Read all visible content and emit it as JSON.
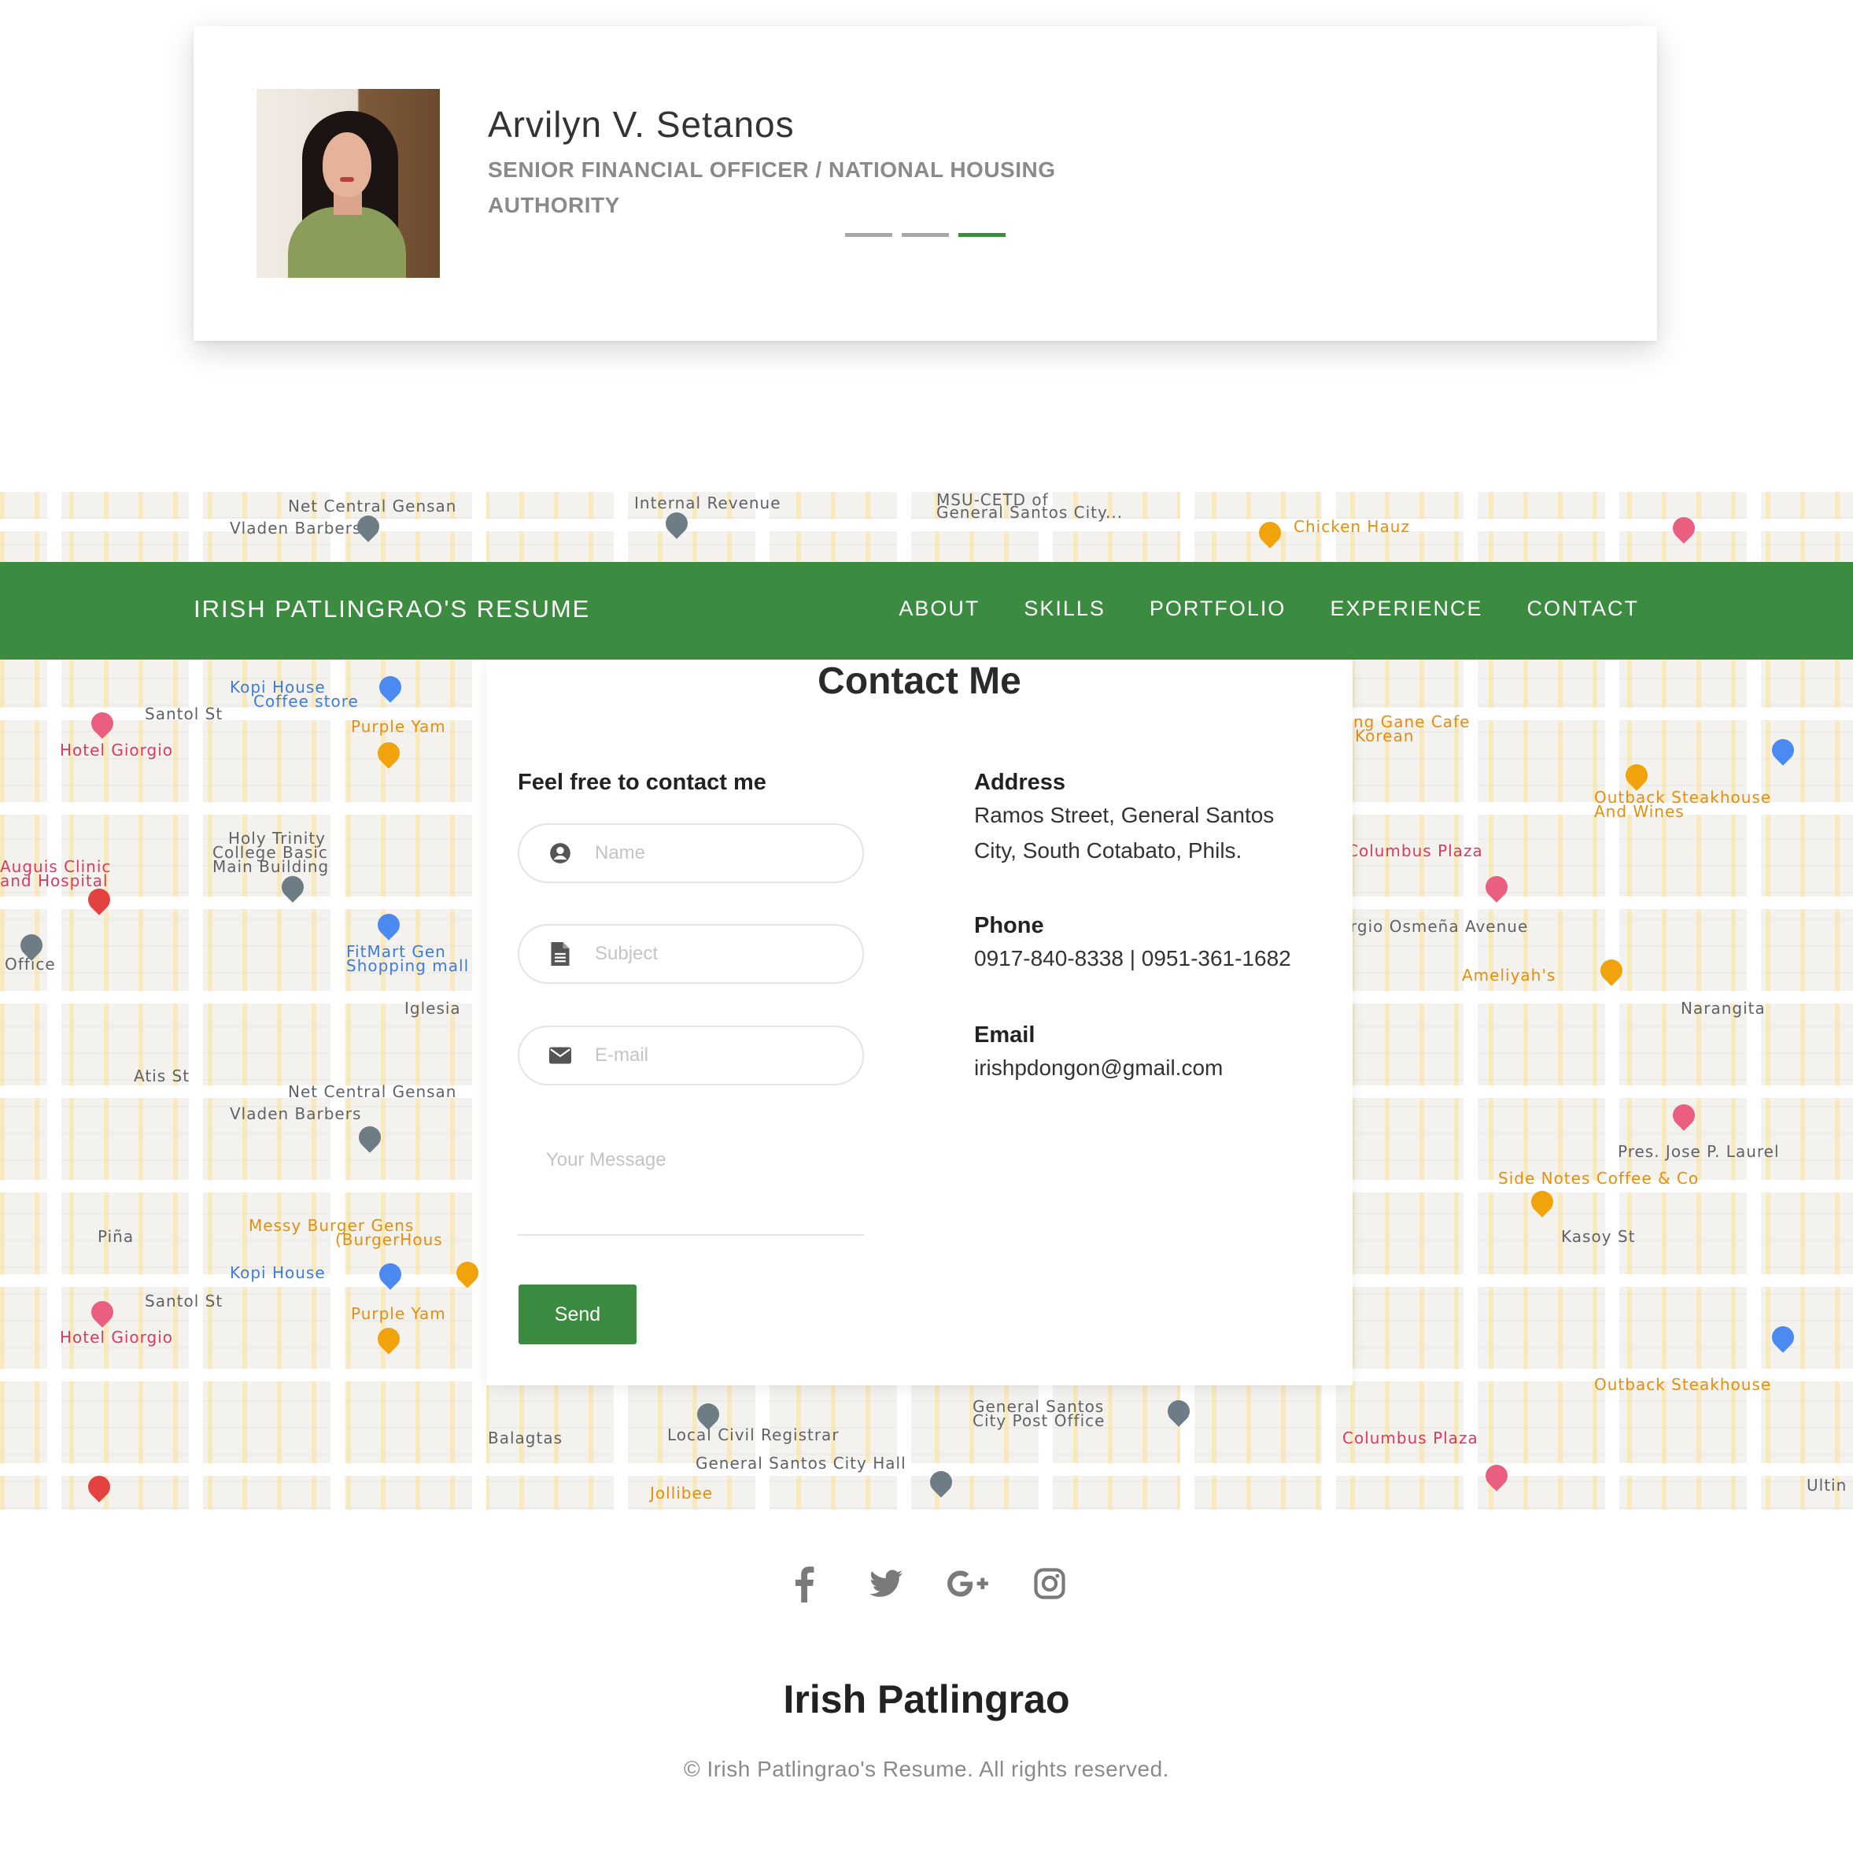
{
  "testimonial": {
    "name": "Arvilyn V. Setanos",
    "role": "SENIOR FINANCIAL OFFICER / NATIONAL HOUSING AUTHORITY",
    "slides_total": 3,
    "slide_active": 3
  },
  "navbar": {
    "brand": "IRISH PATLINGRAO'S RESUME",
    "links": [
      "ABOUT",
      "SKILLS",
      "PORTFOLIO",
      "EXPERIENCE",
      "CONTACT"
    ]
  },
  "map": {
    "labels": [
      "Net Central Gensan",
      "Vladen Barbers",
      "Internal Revenue",
      "MSU-CETD of",
      "General Santos City...",
      "Chicken Hauz",
      "Kopi House",
      "Coffee store",
      "Santol St",
      "Hotel Giorgio",
      "Purple Yam",
      "Holy Trinity",
      "College Basic",
      "Main Building",
      "Auguis Clinic",
      "and Hospital",
      "Office",
      "FitMart Gen",
      "Shopping mall",
      "Iglesia",
      "Atis St",
      "ng Gane Cafe",
      "Korean",
      "Outback Steakhouse",
      "And Wines",
      "Columbus Plaza",
      "rgio Osmeña Avenue",
      "Ameliyah's",
      "Narangita",
      "Pres. Jose P. Laurel",
      "Side Notes Coffee & Co",
      "Kasoy St",
      "Messy Burger Gens",
      "(BurgerHous",
      "Piña",
      "Balagtas",
      "Local Civil Registrar",
      "General Santos City Hall",
      "General Santos",
      "City Post Office",
      "Jollibee",
      "Ultin"
    ]
  },
  "contact": {
    "title": "Contact Me",
    "form_title": "Feel free to contact me",
    "name_placeholder": "Name",
    "subject_placeholder": "Subject",
    "email_placeholder": "E-mail",
    "message_placeholder": "Your Message",
    "send_label": "Send",
    "address_label": "Address",
    "address_value": "Ramos Street, General Santos City, South Cotabato, Phils.",
    "phone_label": "Phone",
    "phone_value": "0917-840-8338 | 0951-361-1682",
    "email_label": "Email",
    "email_value": "irishpdongon@gmail.com"
  },
  "footer": {
    "social_icons": [
      "facebook-icon",
      "twitter-icon",
      "google-plus-icon",
      "instagram-icon"
    ],
    "name": "Irish Patlingrao",
    "copyright": "© Irish Patlingrao's Resume. All rights reserved."
  },
  "colors": {
    "accent": "#3b8b40",
    "muted_text": "#8a8a8a",
    "icon_gray": "#7a7a7a"
  }
}
